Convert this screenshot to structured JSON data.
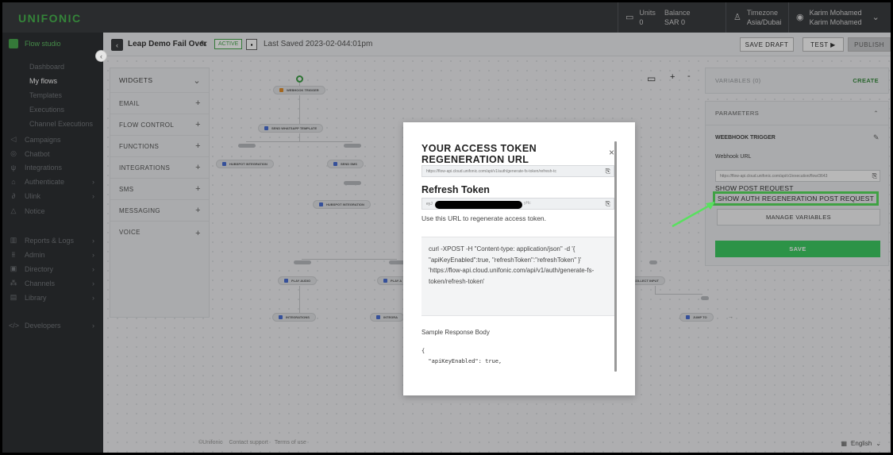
{
  "app": {
    "logo": "UNIFONIC"
  },
  "topbar": {
    "units_label": "Units",
    "units_value": "0",
    "balance_label": "Balance",
    "balance_value": "SAR 0",
    "timezone_label": "Timezone",
    "timezone_value": "Asia/Dubai",
    "user_name": "Karim Mohamed",
    "user_sub": "Karim Mohamed"
  },
  "sidebar": {
    "top": "Flow studio",
    "sub_items": [
      "Dashboard",
      "My flows",
      "Templates",
      "Executions",
      "Channel Executions"
    ],
    "active_sub": "My flows",
    "main_items": [
      "Campaigns",
      "Chatbot",
      "Integrations",
      "Authenticate",
      "Ulink",
      "Notice"
    ],
    "main_items2": [
      "Reports & Logs",
      "Admin",
      "Directory",
      "Channels",
      "Library"
    ],
    "developers": "Developers"
  },
  "header": {
    "flow_name": "Leap Demo Fail Over",
    "status": "ACTIVE",
    "last_saved": "Last Saved 2023-02-044:01pm",
    "save_draft": "SAVE DRAFT",
    "test": "TEST ▶",
    "publish": "PUBLISH"
  },
  "widgets": {
    "title": "WIDGETS",
    "items": [
      "EMAIL",
      "FLOW CONTROL",
      "FUNCTIONS",
      "INTEGRATIONS",
      "SMS",
      "MESSAGING",
      "VOICE"
    ]
  },
  "flow_nodes": {
    "webhook_trigger": "WEBHOOK TRIGGER",
    "send_whatsapp": "SEND WHATSAPP TEMPLATE",
    "hubspot1": "HUBSPOT INTEGRATION",
    "send_sms": "SEND SMS",
    "hubspot2": "HUBSPOT INTEGRATION",
    "play_audio1": "PLAY AUDIO",
    "play_audio2": "PLAY A",
    "collect_input": "COLLECT INPUT",
    "integrations1": "INTEGRATIONS",
    "integrations2": "INTEGRA",
    "jump_to": "JUMP TO"
  },
  "variables": {
    "title": "VARIABLES (0)",
    "create": "CREATE"
  },
  "parameters": {
    "title": "PARAMETERS",
    "trigger_title": "WEEBHOOK TRIGGER",
    "webhook_label": "Webhook URL",
    "webhook_url": "https://flow-api.cloud.unifonic.com/api/v1/execution/flow/3643",
    "show_post": "SHOW POST REQUEST",
    "show_auth": "SHOW AUTH REGENERATION POST REQUEST",
    "manage_variables": "MANAGE VARIABLES",
    "save": "SAVE"
  },
  "modal": {
    "title": "YOUR ACCESS TOKEN REGENERATION URL",
    "url": "https://flow-api.cloud.unifonic.com/api/v1/auth/generate-fs-token/refresh-tc",
    "refresh_title": "Refresh Token",
    "token_prefix": "eyJ",
    "token_suffix": "yHc",
    "description": "Use this URL to regenerate access token.",
    "curl": "curl -XPOST -H \"Content-type: application/json\" -d '{ \"apiKeyEnabled\":true, \"refreshToken\":\"refreshToken\" }' 'https://flow-api.cloud.unifonic.com/api/v1/auth/generate-fs-token/refresh-token'",
    "sample_title": "Sample Response Body",
    "json_open": "{",
    "json_line1": "  \"apiKeyEnabled\": true,"
  },
  "footer": {
    "brand": "©Unifonic",
    "support": "Contact support",
    "terms": "Terms of use",
    "language": "English"
  }
}
